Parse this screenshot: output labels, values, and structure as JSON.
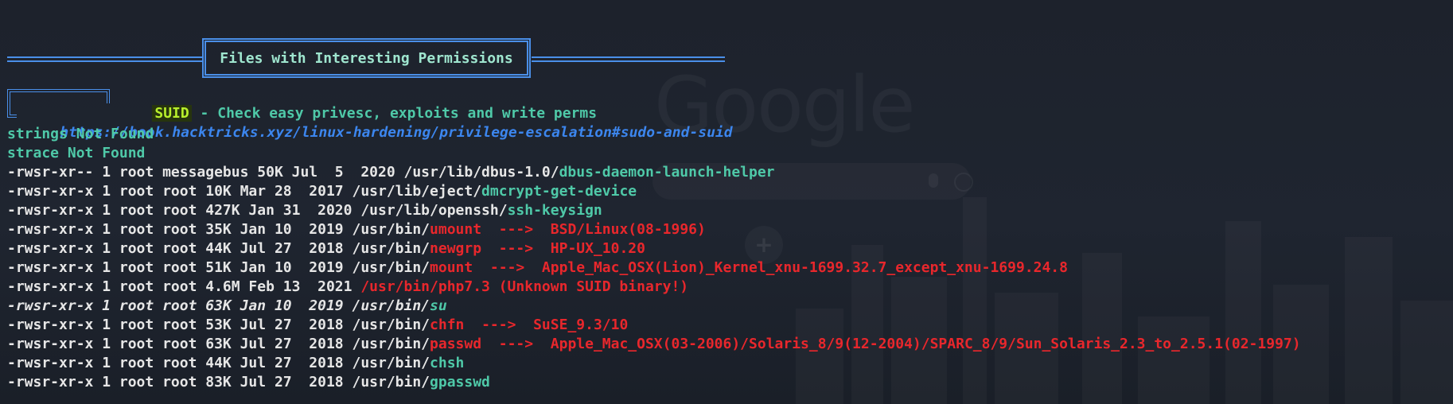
{
  "banner": {
    "title": "Files with Interesting Permissions"
  },
  "section": {
    "badge": "SUID",
    "description": " - Check easy privesc, exploits and write perms",
    "url": "https://book.hacktricks.xyz/linux-hardening/privilege-escalation#sudo-and-suid"
  },
  "notices": [
    "strings Not Found",
    "strace Not Found"
  ],
  "entries": [
    {
      "perm": "-rwsr-xr-- 1 root messagebus 50K Jul  5  2020 ",
      "dir": "/usr/lib/dbus-1.0/",
      "file": "dbus-daemon-launch-helper",
      "arrow": "",
      "exploit": "",
      "style": "normal"
    },
    {
      "perm": "-rwsr-xr-x 1 root root 10K Mar 28  2017 ",
      "dir": "/usr/lib/eject/",
      "file": "dmcrypt-get-device",
      "arrow": "",
      "exploit": "",
      "style": "normal"
    },
    {
      "perm": "-rwsr-xr-x 1 root root 427K Jan 31  2020 ",
      "dir": "/usr/lib/openssh/",
      "file": "ssh-keysign",
      "arrow": "",
      "exploit": "",
      "style": "normal"
    },
    {
      "perm": "-rwsr-xr-x 1 root root 35K Jan 10  2019 ",
      "dir": "/usr/bin/",
      "file": "umount",
      "arrow": "  --->  ",
      "exploit": "BSD/Linux(08-1996)",
      "style": "vuln"
    },
    {
      "perm": "-rwsr-xr-x 1 root root 44K Jul 27  2018 ",
      "dir": "/usr/bin/",
      "file": "newgrp",
      "arrow": "  --->  ",
      "exploit": "HP-UX_10.20",
      "style": "vuln"
    },
    {
      "perm": "-rwsr-xr-x 1 root root 51K Jan 10  2019 ",
      "dir": "/usr/bin/",
      "file": "mount",
      "arrow": "  --->  ",
      "exploit": "Apple_Mac_OSX(Lion)_Kernel_xnu-1699.32.7_except_xnu-1699.24.8",
      "style": "vuln"
    },
    {
      "perm": "-rwsr-xr-x 1 root root 4.6M Feb 13  2021 ",
      "dir": "",
      "file": "/usr/bin/php7.3 (Unknown SUID binary!)",
      "arrow": "",
      "exploit": "",
      "style": "unknown"
    },
    {
      "perm": "-rwsr-xr-x 1 root root 63K Jan 10  2019 ",
      "dir": "/usr/bin/",
      "file": "su",
      "arrow": "",
      "exploit": "",
      "style": "italic"
    },
    {
      "perm": "-rwsr-xr-x 1 root root 53K Jul 27  2018 ",
      "dir": "/usr/bin/",
      "file": "chfn",
      "arrow": "  --->  ",
      "exploit": "SuSE_9.3/10",
      "style": "vuln"
    },
    {
      "perm": "-rwsr-xr-x 1 root root 63K Jul 27  2018 ",
      "dir": "/usr/bin/",
      "file": "passwd",
      "arrow": "  --->  ",
      "exploit": "Apple_Mac_OSX(03-2006)/Solaris_8/9(12-2004)/SPARC_8/9/Sun_Solaris_2.3_to_2.5.1(02-1997)",
      "style": "vuln"
    },
    {
      "perm": "-rwsr-xr-x 1 root root 44K Jul 27  2018 ",
      "dir": "/usr/bin/",
      "file": "chsh",
      "arrow": "",
      "exploit": "",
      "style": "normal"
    },
    {
      "perm": "-rwsr-xr-x 1 root root 83K Jul 27  2018 ",
      "dir": "/usr/bin/",
      "file": "gpasswd",
      "arrow": "",
      "exploit": "",
      "style": "normal"
    }
  ],
  "background": {
    "logo_text": "Google"
  },
  "colors": {
    "background": "#1f2430",
    "banner_border": "#4a8fe8",
    "banner_text": "#9fe6cf",
    "badge_bg": "#27340e",
    "badge_text": "#b8ef2c",
    "teal": "#4fc9a8",
    "white": "#e6e6e6",
    "red": "#e8272c",
    "link_blue": "#3c86ee"
  }
}
